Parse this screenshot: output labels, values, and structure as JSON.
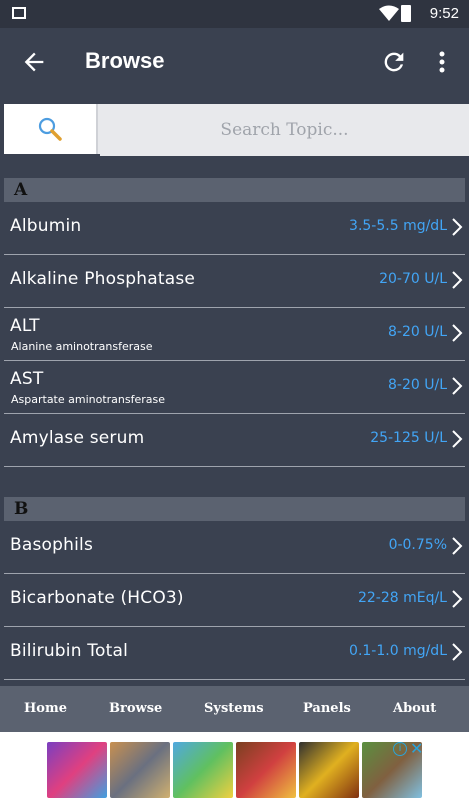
{
  "status": {
    "time": "9:52"
  },
  "appbar": {
    "title": "Browse"
  },
  "search": {
    "placeholder": "Search Topic..."
  },
  "sections": [
    {
      "letter": "A",
      "rows": [
        {
          "name": "Albumin",
          "sub": "",
          "value": "3.5-5.5 mg/dL"
        },
        {
          "name": "Alkaline Phosphatase",
          "sub": "",
          "value": "20-70 U/L"
        },
        {
          "name": "ALT",
          "sub": "Alanine aminotransferase",
          "value": "8-20 U/L"
        },
        {
          "name": "AST",
          "sub": "Aspartate aminotransferase",
          "value": "8-20 U/L"
        },
        {
          "name": "Amylase serum",
          "sub": "",
          "value": "25-125 U/L"
        }
      ]
    },
    {
      "letter": "B",
      "rows": [
        {
          "name": "Basophils",
          "sub": "",
          "value": "0-0.75%"
        },
        {
          "name": "Bicarbonate (HCO3)",
          "sub": "",
          "value": "22-28 mEq/L"
        },
        {
          "name": "Bilirubin Total",
          "sub": "",
          "value": "0.1-1.0 mg/dL"
        }
      ]
    }
  ],
  "nav": {
    "home": "Home",
    "browse": "Browse",
    "systems": "Systems",
    "panels": "Panels",
    "about": "About"
  },
  "ads": {
    "info": "i",
    "close": "✕"
  },
  "colors": {
    "accent": "#42a5f5",
    "background": "#3a4150",
    "header": "#5b6270"
  }
}
